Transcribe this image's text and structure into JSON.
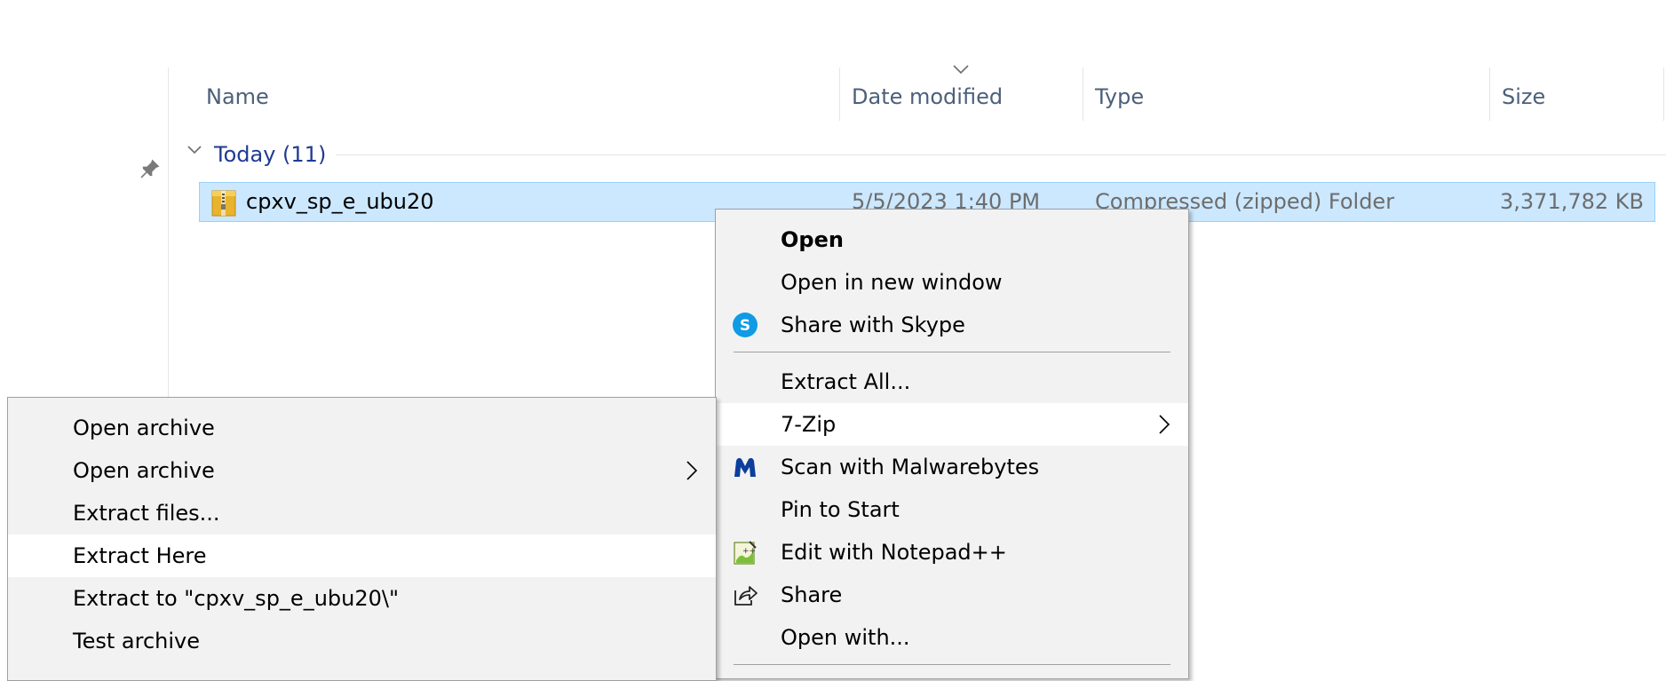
{
  "columns": {
    "name": "Name",
    "date": "Date modified",
    "type": "Type",
    "size": "Size"
  },
  "group": {
    "label": "Today (11)"
  },
  "file": {
    "name": "cpxv_sp_e_ubu20",
    "date": "5/5/2023 1:40 PM",
    "type": "Compressed (zipped) Folder",
    "size": "3,371,782 KB"
  },
  "context_menu": {
    "items": [
      {
        "label": "Open",
        "bold": true
      },
      {
        "label": "Open in new window"
      },
      {
        "label": "Share with Skype",
        "icon": "skype-icon"
      },
      {
        "label": "Extract All..."
      },
      {
        "label": "7-Zip",
        "submenu": true,
        "highlighted": true
      },
      {
        "label": "Scan with Malwarebytes",
        "icon": "malwarebytes-icon"
      },
      {
        "label": "Pin to Start"
      },
      {
        "label": "Edit with Notepad++",
        "icon": "notepadpp-icon"
      },
      {
        "label": "Share",
        "icon": "share-icon"
      },
      {
        "label": "Open with..."
      }
    ]
  },
  "submenu_7zip": {
    "items": [
      {
        "label": "Open archive"
      },
      {
        "label": "Open archive",
        "submenu": true
      },
      {
        "label": "Extract files..."
      },
      {
        "label": "Extract Here",
        "highlighted": true
      },
      {
        "label": "Extract to \"cpxv_sp_e_ubu20\\\""
      },
      {
        "label": "Test archive"
      }
    ]
  },
  "colors": {
    "selection_bg": "#cce8ff",
    "selection_border": "#99d1ff",
    "group_header": "#1f3a93",
    "menu_bg": "#f2f2f2",
    "menu_hover": "#ffffff"
  }
}
